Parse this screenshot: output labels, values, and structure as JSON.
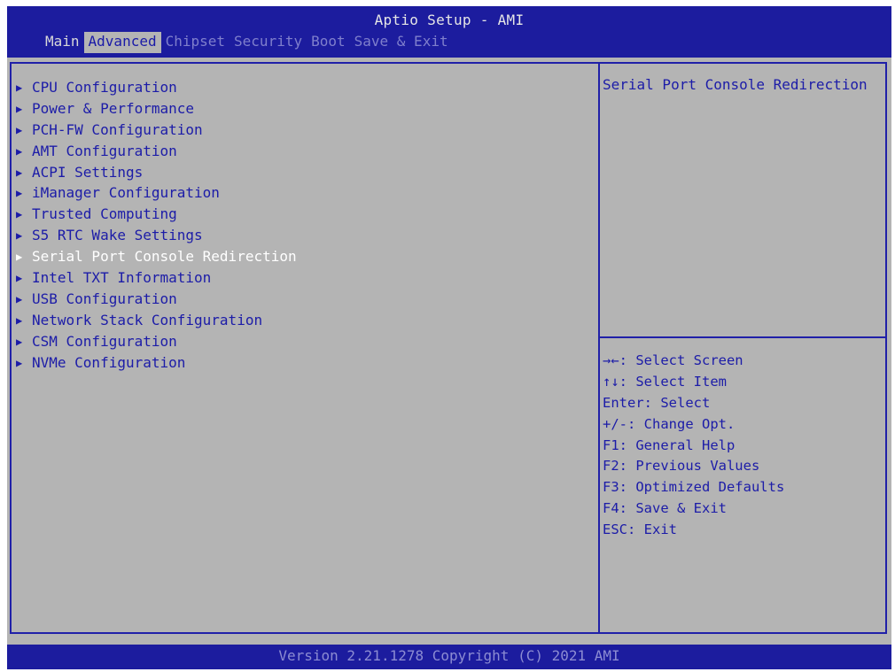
{
  "header": {
    "title": "Aptio Setup - AMI",
    "tabs": [
      {
        "label": "Main"
      },
      {
        "label": "Advanced"
      },
      {
        "label": "Chipset"
      },
      {
        "label": "Security"
      },
      {
        "label": "Boot"
      },
      {
        "label": "Save & Exit"
      }
    ],
    "active_tab": "Advanced"
  },
  "menu": {
    "items": [
      {
        "label": "CPU Configuration"
      },
      {
        "label": "Power & Performance"
      },
      {
        "label": "PCH-FW Configuration"
      },
      {
        "label": "AMT Configuration"
      },
      {
        "label": "ACPI Settings"
      },
      {
        "label": "iManager Configuration"
      },
      {
        "label": "Trusted Computing"
      },
      {
        "label": "S5 RTC Wake Settings"
      },
      {
        "label": "Serial Port Console Redirection"
      },
      {
        "label": "Intel TXT Information"
      },
      {
        "label": "USB Configuration"
      },
      {
        "label": "Network Stack Configuration"
      },
      {
        "label": "CSM Configuration"
      },
      {
        "label": "NVMe Configuration"
      }
    ],
    "selected_item": "Serial Port Console Redirection",
    "arrow_glyph": "▶"
  },
  "help": {
    "description": "Serial Port Console Redirection",
    "keys": [
      "→←: Select Screen",
      "↑↓: Select Item",
      "Enter: Select",
      "+/-: Change Opt.",
      "F1: General Help",
      "F2: Previous Values",
      "F3: Optimized Defaults",
      "F4: Save & Exit",
      "ESC: Exit"
    ]
  },
  "footer": {
    "version": "Version 2.21.1278 Copyright (C) 2021 AMI"
  },
  "colors": {
    "header_bg": "#1c1c9e",
    "body_bg": "#b4b4b4",
    "text_blue": "#1c1ca8",
    "selected_text": "#ffffff"
  }
}
